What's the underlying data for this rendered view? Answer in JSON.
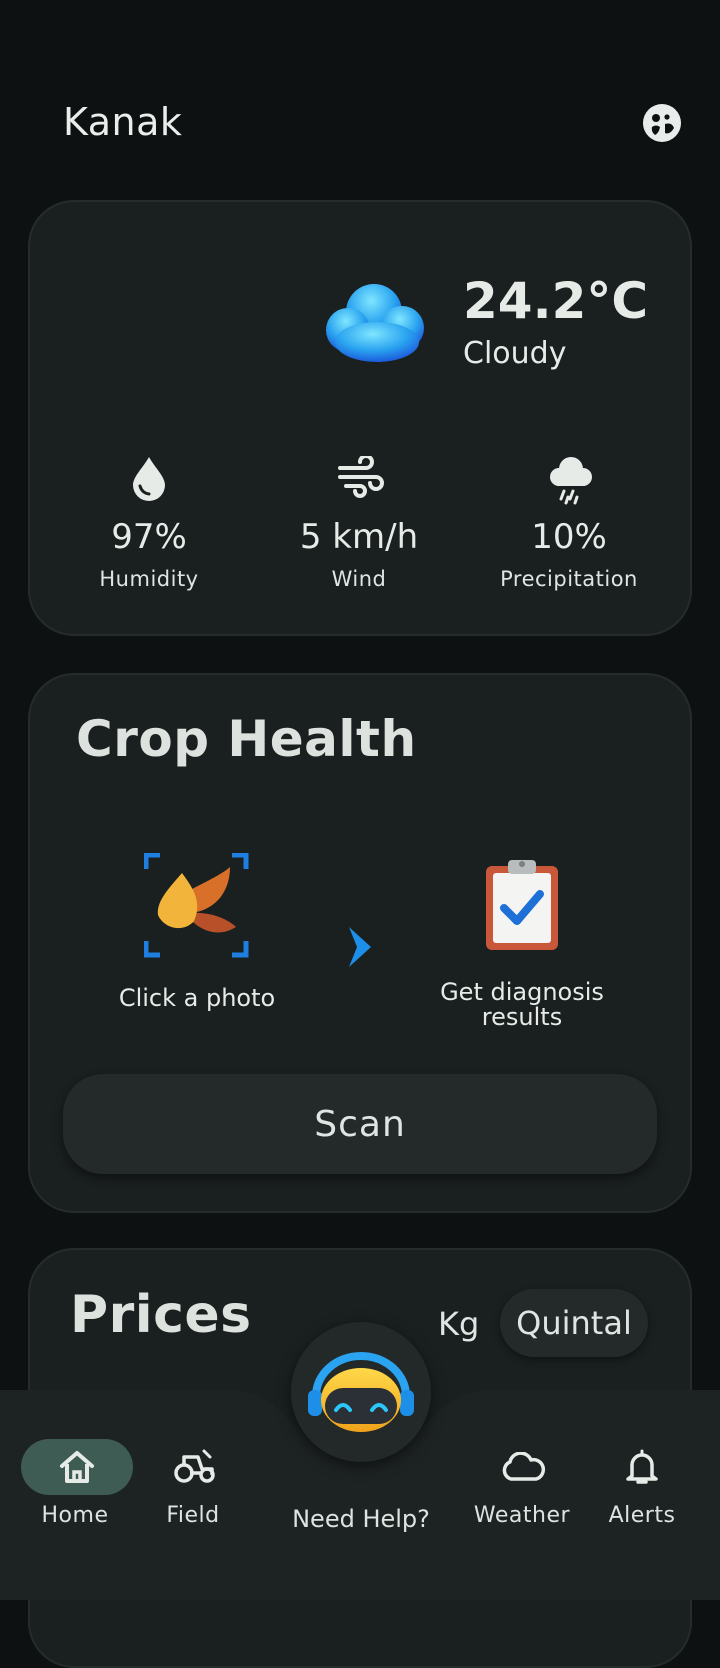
{
  "header": {
    "app_name": "Kanak",
    "profile_icon": "face-profile-icon"
  },
  "weather": {
    "temperature": "24.2°C",
    "condition": "Cloudy",
    "condition_icon": "cloud-3d-icon",
    "stats": [
      {
        "icon": "droplet-icon",
        "value": "97%",
        "label": "Humidity"
      },
      {
        "icon": "wind-icon",
        "value": "5 km/h",
        "label": "Wind"
      },
      {
        "icon": "rain-cloud-icon",
        "value": "10%",
        "label": "Precipitation"
      }
    ]
  },
  "crop_health": {
    "title": "Crop Health",
    "steps": [
      {
        "icon": "leaf-scan-icon",
        "label": "Click a photo"
      },
      {
        "icon": "clipboard-check-icon",
        "label": "Get diagnosis results"
      }
    ],
    "scan_label": "Scan"
  },
  "prices": {
    "title": "Prices",
    "units": [
      "Kg",
      "Quintal"
    ],
    "selected_unit": "Quintal"
  },
  "nav": {
    "items": [
      {
        "label": "Home",
        "icon": "home-icon",
        "active": true
      },
      {
        "label": "Field",
        "icon": "tractor-icon",
        "active": false
      },
      {
        "label": "Need Help?",
        "icon": "robot-assistant-icon",
        "active": false
      },
      {
        "label": "Weather",
        "icon": "cloud-icon",
        "active": false
      },
      {
        "label": "Alerts",
        "icon": "bell-icon",
        "active": false
      }
    ]
  },
  "colors": {
    "background": "#0d1112",
    "card": "#1a1f1f",
    "accent_blue": "#1e90ff",
    "home_active": "#3e5b54"
  }
}
